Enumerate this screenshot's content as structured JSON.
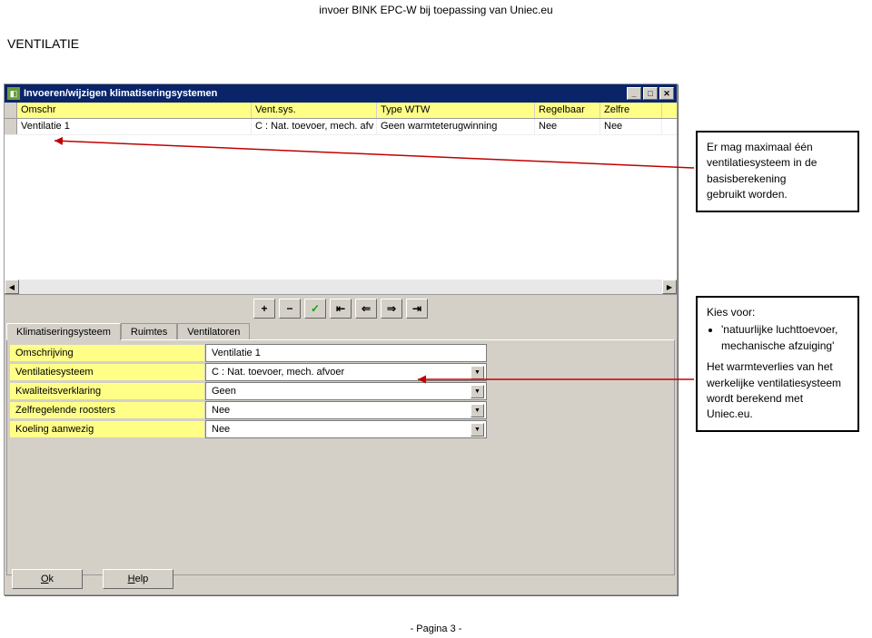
{
  "header": "invoer BINK EPC-W bij toepassing van Uniec.eu",
  "section_title": "VENTILATIE",
  "window": {
    "title": "Invoeren/wijzigen klimatiseringsystemen",
    "grid": {
      "columns": {
        "omschr": "Omschr",
        "vent": "Vent.sys.",
        "type": "Type WTW",
        "regel": "Regelbaar",
        "zelf": "Zelfre"
      },
      "row": {
        "omschr": "Ventilatie 1",
        "vent": "C : Nat. toevoer, mech. afv",
        "type": "Geen warmteterugwinning",
        "regel": "Nee",
        "zelf": "Nee"
      }
    },
    "toolbar": {
      "add": "+",
      "remove": "−",
      "confirm": "✓",
      "first": "⇤",
      "prev": "⇐",
      "next": "⇒",
      "last": "⇥"
    },
    "tabs": {
      "t0": "Klimatiseringsysteem",
      "t1": "Ruimtes",
      "t2": "Ventilatoren"
    },
    "form": {
      "labels": {
        "omschrijving": "Omschrijving",
        "ventilatiesysteem": "Ventilatiesysteem",
        "kwaliteits": "Kwaliteitsverklaring",
        "zelfregelende": "Zelfregelende roosters",
        "koeling": "Koeling aanwezig"
      },
      "values": {
        "omschrijving": "Ventilatie 1",
        "ventilatiesysteem": "C : Nat. toevoer, mech. afvoer",
        "kwaliteits": "Geen",
        "zelfregelende": "Nee",
        "koeling": "Nee"
      }
    },
    "buttons": {
      "ok_u": "O",
      "ok_rest": "k",
      "help_u": "H",
      "help_rest": "elp"
    }
  },
  "callout1": {
    "line1": "Er mag maximaal één",
    "line2": "ventilatiesysteem in de",
    "line3": "basisberekening",
    "line4": "gebruikt worden."
  },
  "callout2": {
    "intro": "Kies voor:",
    "bullet1": "'natuurlijke luchttoevoer, mechanische afzuiging'",
    "p1": "Het warmteverlies van het werkelijke ventilatiesysteem wordt berekend met Uniec.eu."
  },
  "footer": "- Pagina 3 -"
}
